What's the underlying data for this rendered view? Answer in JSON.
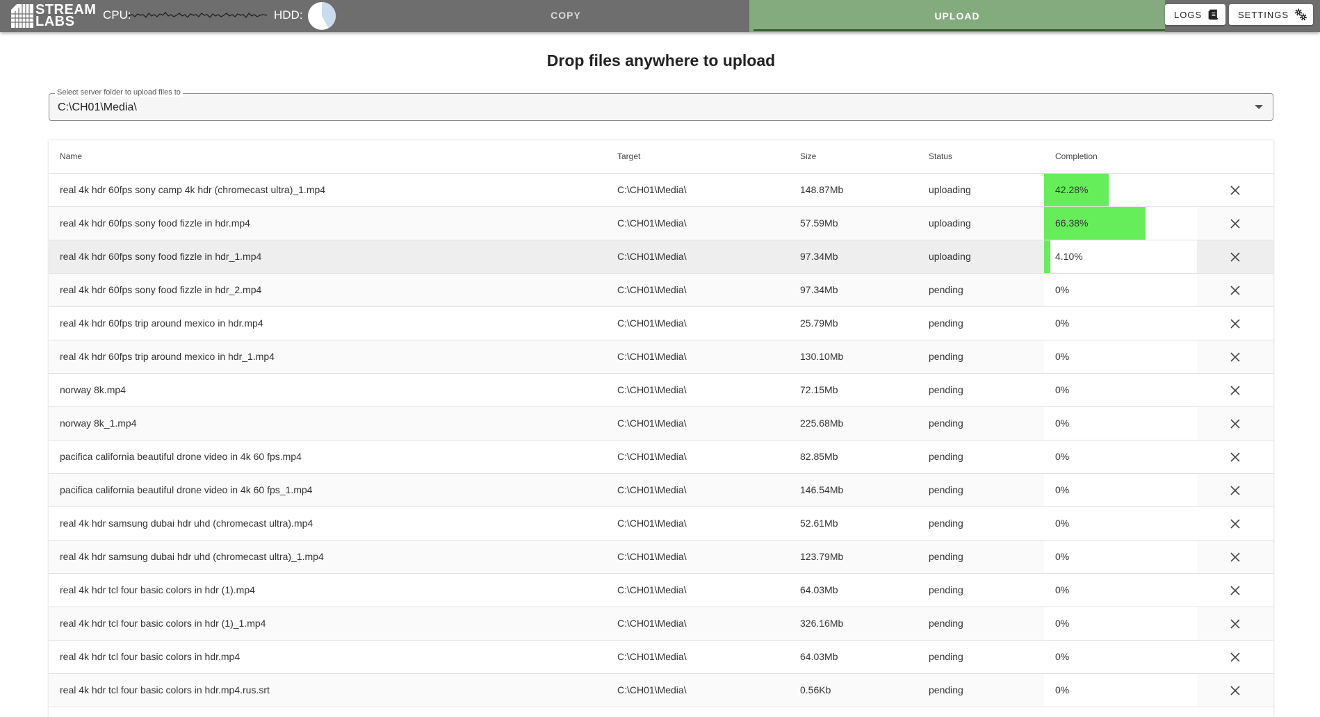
{
  "header": {
    "logo_line1": "STREAM",
    "logo_line2": "LABS",
    "cpu_label": "CPU:",
    "hdd_label": "HDD:",
    "hdd_usage_fraction": 0.42,
    "tabs": [
      {
        "label": "COPY",
        "active": false
      },
      {
        "label": "UPLOAD",
        "active": true
      }
    ],
    "logs_label": "LOGS",
    "settings_label": "SETTINGS",
    "active_tab_color": "#84ab7d",
    "bar_color": "#6e6e6e"
  },
  "main": {
    "heading": "Drop files anywhere to upload",
    "folder_select": {
      "legend": "Select server folder to upload files to",
      "value": "C:\\CH01\\Media\\"
    },
    "columns": [
      "Name",
      "Target",
      "Size",
      "Status",
      "Completion"
    ],
    "progress_color": "#66ee5a",
    "rows": [
      {
        "name": "real 4k hdr 60fps sony camp 4k hdr (chromecast ultra)_1.mp4",
        "target": "C:\\CH01\\Media\\",
        "size": "148.87Mb",
        "status": "uploading",
        "completion": "42.28%",
        "progress": 0.4228
      },
      {
        "name": "real 4k hdr 60fps sony food fizzle in hdr.mp4",
        "target": "C:\\CH01\\Media\\",
        "size": "57.59Mb",
        "status": "uploading",
        "completion": "66.38%",
        "progress": 0.6638
      },
      {
        "name": "real 4k hdr 60fps sony food fizzle in hdr_1.mp4",
        "target": "C:\\CH01\\Media\\",
        "size": "97.34Mb",
        "status": "uploading",
        "completion": "4.10%",
        "progress": 0.041,
        "highlighted": true
      },
      {
        "name": "real 4k hdr 60fps sony food fizzle in hdr_2.mp4",
        "target": "C:\\CH01\\Media\\",
        "size": "97.34Mb",
        "status": "pending",
        "completion": "0%",
        "progress": 0
      },
      {
        "name": "real 4k hdr 60fps trip around mexico in hdr.mp4",
        "target": "C:\\CH01\\Media\\",
        "size": "25.79Mb",
        "status": "pending",
        "completion": "0%",
        "progress": 0
      },
      {
        "name": "real 4k hdr 60fps trip around mexico in hdr_1.mp4",
        "target": "C:\\CH01\\Media\\",
        "size": "130.10Mb",
        "status": "pending",
        "completion": "0%",
        "progress": 0
      },
      {
        "name": "norway 8k.mp4",
        "target": "C:\\CH01\\Media\\",
        "size": "72.15Mb",
        "status": "pending",
        "completion": "0%",
        "progress": 0
      },
      {
        "name": "norway 8k_1.mp4",
        "target": "C:\\CH01\\Media\\",
        "size": "225.68Mb",
        "status": "pending",
        "completion": "0%",
        "progress": 0
      },
      {
        "name": "pacifica california beautiful drone video in 4k 60 fps.mp4",
        "target": "C:\\CH01\\Media\\",
        "size": "82.85Mb",
        "status": "pending",
        "completion": "0%",
        "progress": 0
      },
      {
        "name": "pacifica california beautiful drone video in 4k 60 fps_1.mp4",
        "target": "C:\\CH01\\Media\\",
        "size": "146.54Mb",
        "status": "pending",
        "completion": "0%",
        "progress": 0
      },
      {
        "name": "real 4k hdr samsung dubai hdr uhd (chromecast ultra).mp4",
        "target": "C:\\CH01\\Media\\",
        "size": "52.61Mb",
        "status": "pending",
        "completion": "0%",
        "progress": 0
      },
      {
        "name": "real 4k hdr samsung dubai hdr uhd (chromecast ultra)_1.mp4",
        "target": "C:\\CH01\\Media\\",
        "size": "123.79Mb",
        "status": "pending",
        "completion": "0%",
        "progress": 0
      },
      {
        "name": "real 4k hdr tcl four basic colors in hdr (1).mp4",
        "target": "C:\\CH01\\Media\\",
        "size": "64.03Mb",
        "status": "pending",
        "completion": "0%",
        "progress": 0
      },
      {
        "name": "real 4k hdr tcl four basic colors in hdr (1)_1.mp4",
        "target": "C:\\CH01\\Media\\",
        "size": "326.16Mb",
        "status": "pending",
        "completion": "0%",
        "progress": 0
      },
      {
        "name": "real 4k hdr tcl four basic colors in hdr.mp4",
        "target": "C:\\CH01\\Media\\",
        "size": "64.03Mb",
        "status": "pending",
        "completion": "0%",
        "progress": 0
      },
      {
        "name": "real 4k hdr tcl four basic colors in hdr.mp4.rus.srt",
        "target": "C:\\CH01\\Media\\",
        "size": "0.56Kb",
        "status": "pending",
        "completion": "0%",
        "progress": 0
      }
    ]
  }
}
